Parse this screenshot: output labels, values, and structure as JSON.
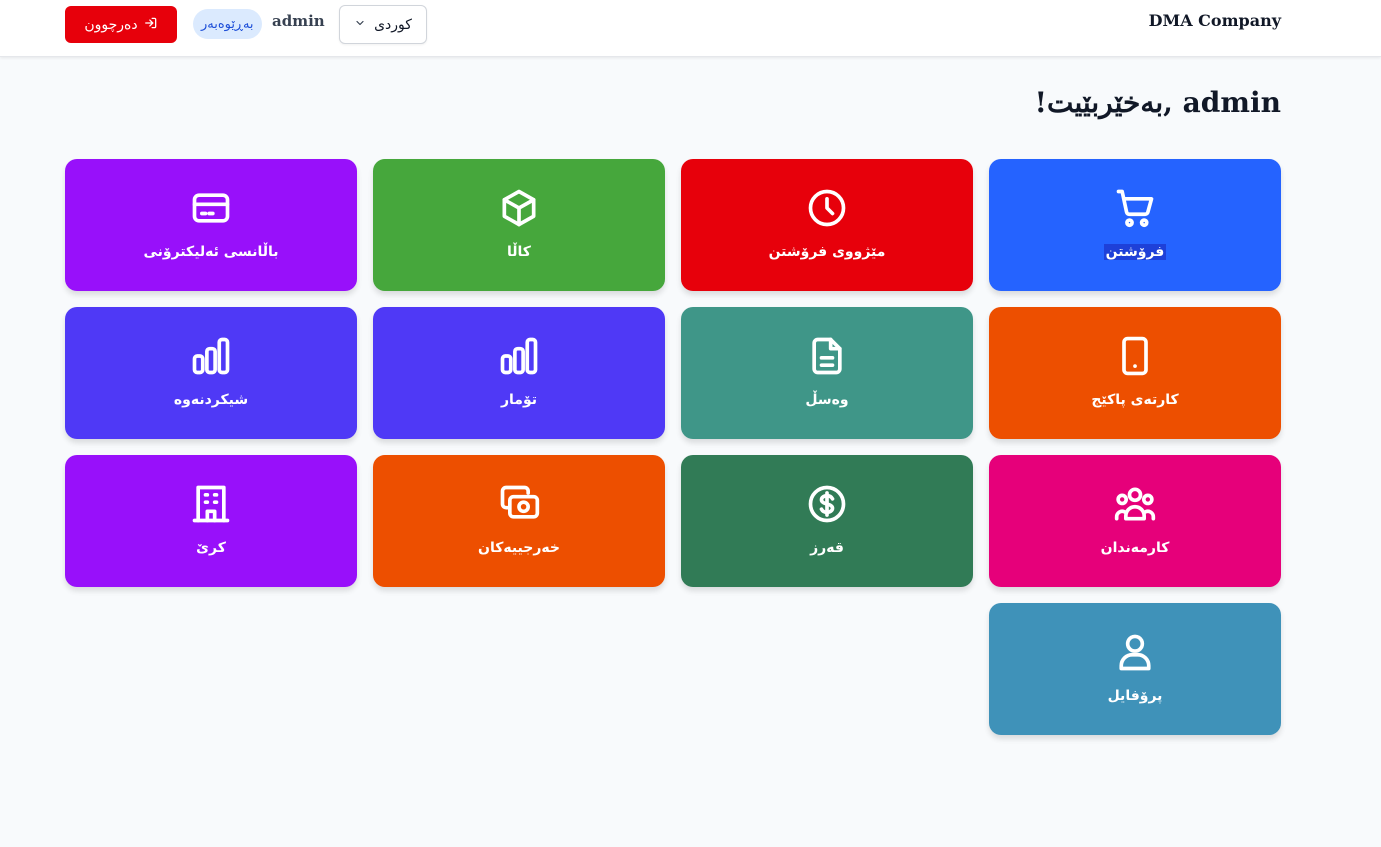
{
  "header": {
    "company": "DMA Company",
    "logout_label": "دەرچوون",
    "role_badge": "بەڕێوەبەر",
    "username": "admin",
    "language": "كوردی"
  },
  "welcome": "!بەخێربێیت, admin",
  "cards": [
    {
      "label": "فرۆشتن",
      "icon": "shopping-cart-icon",
      "color": "#2563ff"
    },
    {
      "label": "مێژووی فرۆشتن",
      "icon": "clock-icon",
      "color": "#e7000b"
    },
    {
      "label": "کاڵا",
      "icon": "box-icon",
      "color": "#46a73c"
    },
    {
      "label": "باڵانسی ئەلیکترۆنی",
      "icon": "credit-card-icon",
      "color": "#9810fa"
    },
    {
      "label": "کارتەی پاکێج",
      "icon": "phone-icon",
      "color": "#ed4f00"
    },
    {
      "label": "وەسڵ",
      "icon": "document-icon",
      "color": "#3f9688"
    },
    {
      "label": "تۆمار",
      "icon": "bar-chart-icon",
      "color": "#4f39f6"
    },
    {
      "label": "شیکردنەوە",
      "icon": "bar-chart-icon",
      "color": "#4f39f6"
    },
    {
      "label": "کارمەندان",
      "icon": "users-icon",
      "color": "#e6007a"
    },
    {
      "label": "قەرز",
      "icon": "dollar-icon",
      "color": "#317b56"
    },
    {
      "label": "خەرجییەکان",
      "icon": "cash-icon",
      "color": "#ed4f00"
    },
    {
      "label": "کرێ",
      "icon": "building-icon",
      "color": "#9810fa"
    },
    {
      "label": "پرۆفایل",
      "icon": "user-icon",
      "color": "#3f92b9"
    }
  ]
}
